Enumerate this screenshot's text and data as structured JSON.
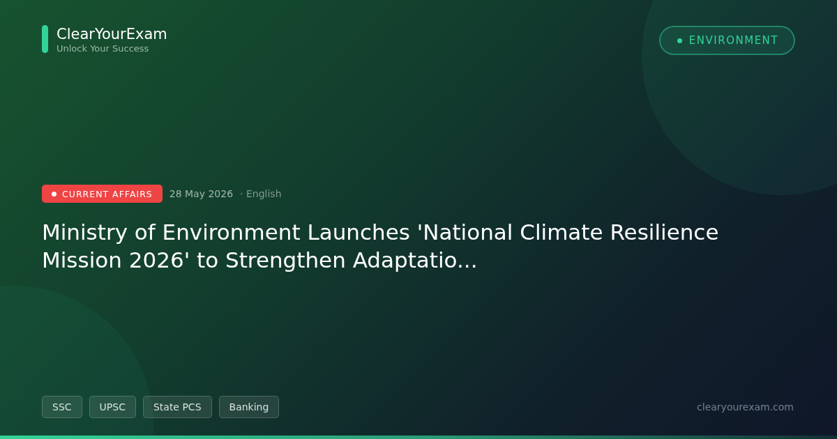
{
  "brand": {
    "name": "ClearYourExam",
    "tagline": "Unlock Your Success"
  },
  "topic_badge": {
    "label": "ENVIRONMENT"
  },
  "category_badge": {
    "label": "CURRENT AFFAIRS"
  },
  "date": "28 May 2026",
  "language": "· English",
  "headline": "Ministry of Environment Launches 'National Climate Resilience Mission 2026' to Strengthen Adaptatio...",
  "exam_tags": [
    "SSC",
    "UPSC",
    "State PCS",
    "Banking"
  ],
  "site_url": "clearyourexam.com"
}
